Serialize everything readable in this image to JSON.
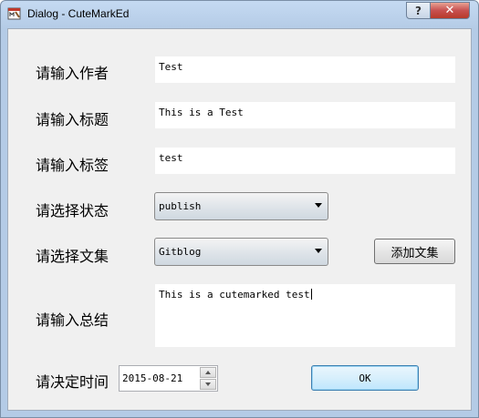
{
  "window": {
    "title": "Dialog - CuteMarkEd",
    "help_glyph": "?",
    "close_glyph": "✕"
  },
  "form": {
    "author_label": "请输入作者",
    "author_value": "Test",
    "title_label": "请输入标题",
    "title_value": "This is a Test",
    "tags_label": "请输入标签",
    "tags_value": "test",
    "status_label": "请选择状态",
    "status_value": "publish",
    "collection_label": "请选择文集",
    "collection_value": "Gitblog",
    "add_collection_label": "添加文集",
    "summary_label": "请输入总结",
    "summary_value": "This is a cutemarked test",
    "time_label": "请决定时间",
    "time_value": "2015-08-21",
    "ok_label": "OK"
  }
}
